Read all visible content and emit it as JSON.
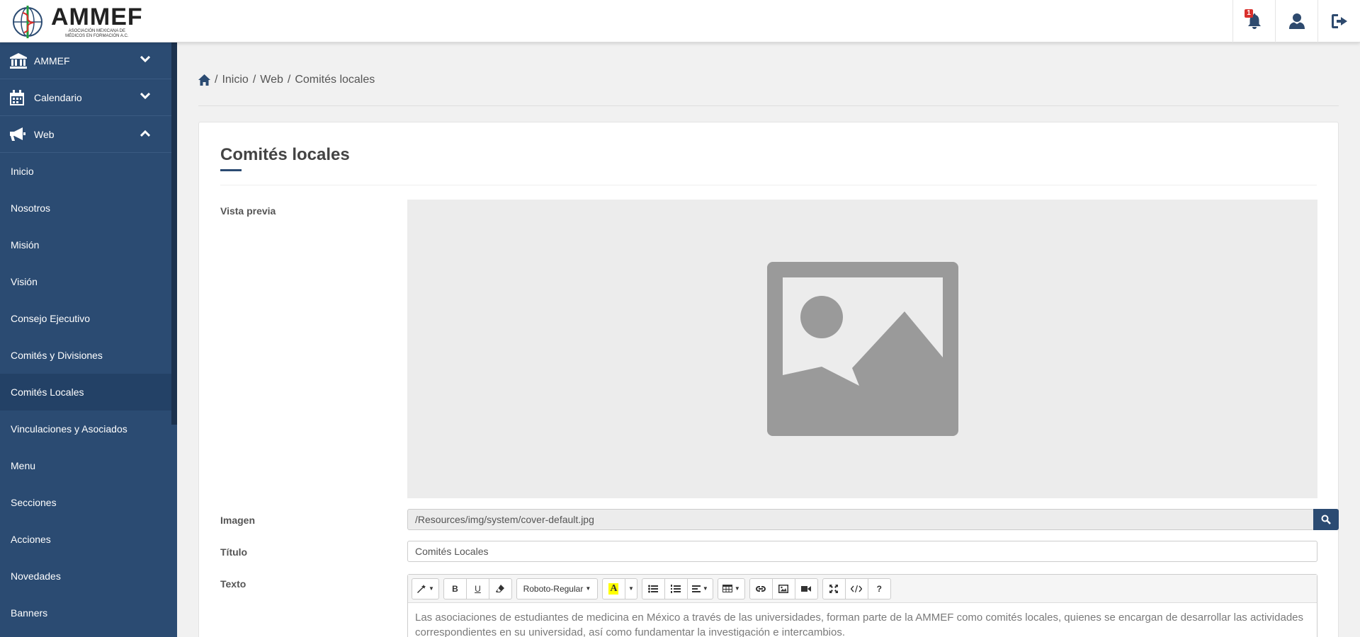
{
  "header": {
    "logo_title": "AMMEF",
    "logo_subtitle": "ASOCIACIÓN MEXICANA DE MÉDICOS EN FORMACIÓN A.C.",
    "notification_count": "1"
  },
  "sidebar": {
    "groups": [
      {
        "label": "AMMEF",
        "icon": "bank-icon",
        "expanded": false
      },
      {
        "label": "Calendario",
        "icon": "calendar-icon",
        "expanded": false
      },
      {
        "label": "Web",
        "icon": "megaphone-icon",
        "expanded": true
      }
    ],
    "items": [
      {
        "label": "Inicio"
      },
      {
        "label": "Nosotros"
      },
      {
        "label": "Misión"
      },
      {
        "label": "Visión"
      },
      {
        "label": "Consejo Ejecutivo"
      },
      {
        "label": "Comités y Divisiones"
      },
      {
        "label": "Comités Locales",
        "active": true
      },
      {
        "label": "Vinculaciones y Asociados"
      },
      {
        "label": "Menu"
      },
      {
        "label": "Secciones"
      },
      {
        "label": "Acciones"
      },
      {
        "label": "Novedades"
      },
      {
        "label": "Banners"
      }
    ]
  },
  "breadcrumb": [
    "Inicio",
    "Web",
    "Comités locales"
  ],
  "card": {
    "title": "Comités locales",
    "preview_label": "Vista previa",
    "image_label": "Imagen",
    "image_value": "/Resources/img/system/cover-default.jpg",
    "title_label": "Título",
    "title_value": "Comités Locales",
    "text_label": "Texto",
    "font_name": "Roboto-Regular",
    "text_value": "Las asociaciones de estudiantes de medicina en México a través de las universidades, forman parte de la AMMEF como comités locales, quienes se encargan de desarrollar las actividades correspondientes en su universidad, así como fundamentar la investigación e intercambios."
  },
  "colors": {
    "sidebar": "#2b4b72",
    "sidebar_active": "#234166",
    "accent": "#2b4b72",
    "badge": "#d9302c"
  }
}
